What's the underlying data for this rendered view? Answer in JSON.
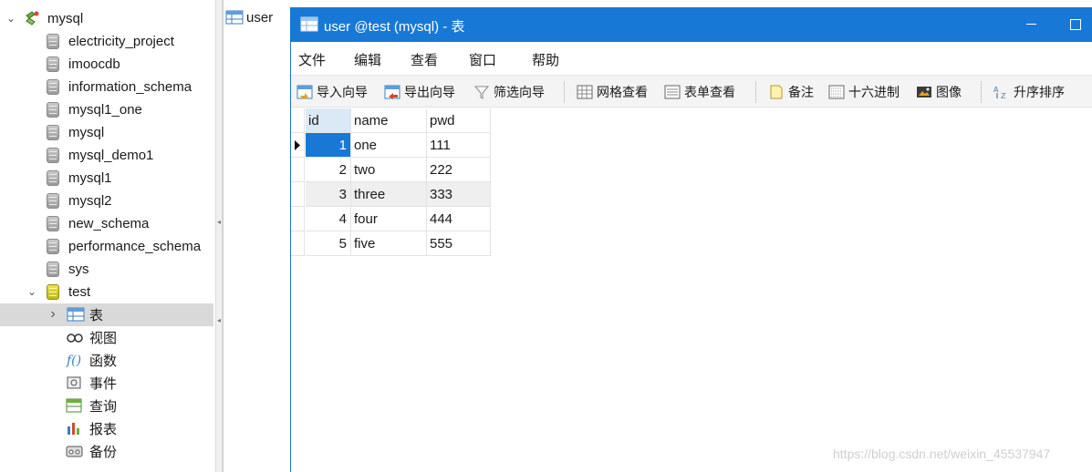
{
  "tree": {
    "connection": "mysql",
    "databases": [
      "electricity_project",
      "imoocdb",
      "information_schema",
      "mysql1_one",
      "mysql",
      "mysql_demo1",
      "mysql1",
      "mysql2",
      "new_schema",
      "performance_schema",
      "sys"
    ],
    "open_db": "test",
    "children": [
      {
        "label": "表",
        "icon": "table-icon"
      },
      {
        "label": "视图",
        "icon": "view-icon"
      },
      {
        "label": "函数",
        "icon": "function-icon"
      },
      {
        "label": "事件",
        "icon": "event-icon"
      },
      {
        "label": "查询",
        "icon": "query-icon"
      },
      {
        "label": "报表",
        "icon": "report-icon"
      },
      {
        "label": "备份",
        "icon": "backup-icon"
      }
    ]
  },
  "object_list": {
    "item": "user"
  },
  "window": {
    "title": "user @test (mysql) - 表",
    "menu": [
      "文件",
      "编辑",
      "查看",
      "窗口",
      "帮助"
    ],
    "toolbar": [
      "导入向导",
      "导出向导",
      "筛选向导",
      "网格查看",
      "表单查看",
      "备注",
      "十六进制",
      "图像",
      "升序排序"
    ]
  },
  "grid": {
    "columns": [
      "id",
      "name",
      "pwd"
    ],
    "rows": [
      [
        "1",
        "one",
        "111"
      ],
      [
        "2",
        "two",
        "222"
      ],
      [
        "3",
        "three",
        "333"
      ],
      [
        "4",
        "four",
        "444"
      ],
      [
        "5",
        "five",
        "555"
      ]
    ]
  },
  "watermark": "https://blog.csdn.net/weixin_45537947",
  "colors": {
    "titlebar": "#1878d6",
    "selection": "#1878d6",
    "tree_selected": "#d9d9d9"
  }
}
